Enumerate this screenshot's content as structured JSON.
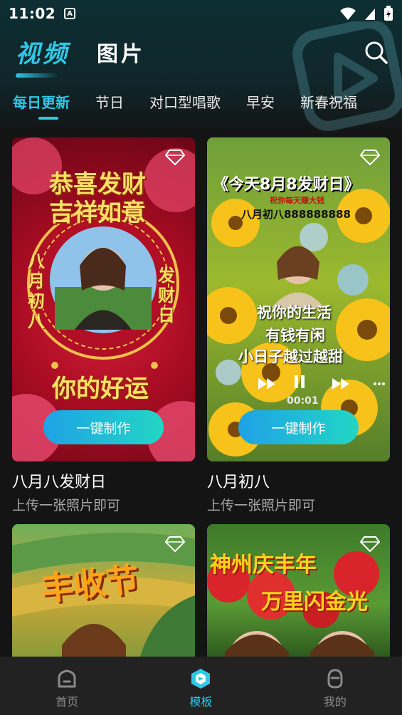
{
  "status": {
    "time": "11:02",
    "badge": "A"
  },
  "header": {
    "tabs": [
      {
        "label": "视频",
        "active": true
      },
      {
        "label": "图片",
        "active": false
      }
    ],
    "search_icon": "search-icon"
  },
  "categories": [
    "每日更新",
    "节日",
    "对口型唱歌",
    "早安",
    "新春祝福"
  ],
  "active_category": 0,
  "cards": [
    {
      "title": "八月八发财日",
      "subtitle": "上传一张照片即可",
      "button": "一键制作",
      "poster": {
        "line1": "恭喜发财",
        "line2": "吉祥如意",
        "left": "八月初八",
        "right": "发财日",
        "bottom": "你的好运"
      }
    },
    {
      "title": "八月初八",
      "subtitle": "上传一张照片即可",
      "button": "一键制作",
      "poster": {
        "headline": "《今天8月8发财日》",
        "small": "祝你每天赚大钱",
        "date": "八月初八888888888",
        "lyric1": "祝你的生活",
        "lyric2": "有钱有闲",
        "lyric3": "小日子越过越甜",
        "timer": "00:01"
      }
    },
    {
      "poster": {
        "headline": "丰收节"
      }
    },
    {
      "poster": {
        "line1": "神州庆丰年",
        "line2": "万里闪金光"
      }
    }
  ],
  "bottom_nav": [
    {
      "label": "首页",
      "icon": "home-icon",
      "active": false
    },
    {
      "label": "模板",
      "icon": "template-icon",
      "active": true
    },
    {
      "label": "我的",
      "icon": "profile-icon",
      "active": false
    }
  ],
  "colors": {
    "accent": "#2ec8e8",
    "button_start": "#1fa2e6",
    "button_end": "#22d6c4",
    "background": "#141414"
  }
}
